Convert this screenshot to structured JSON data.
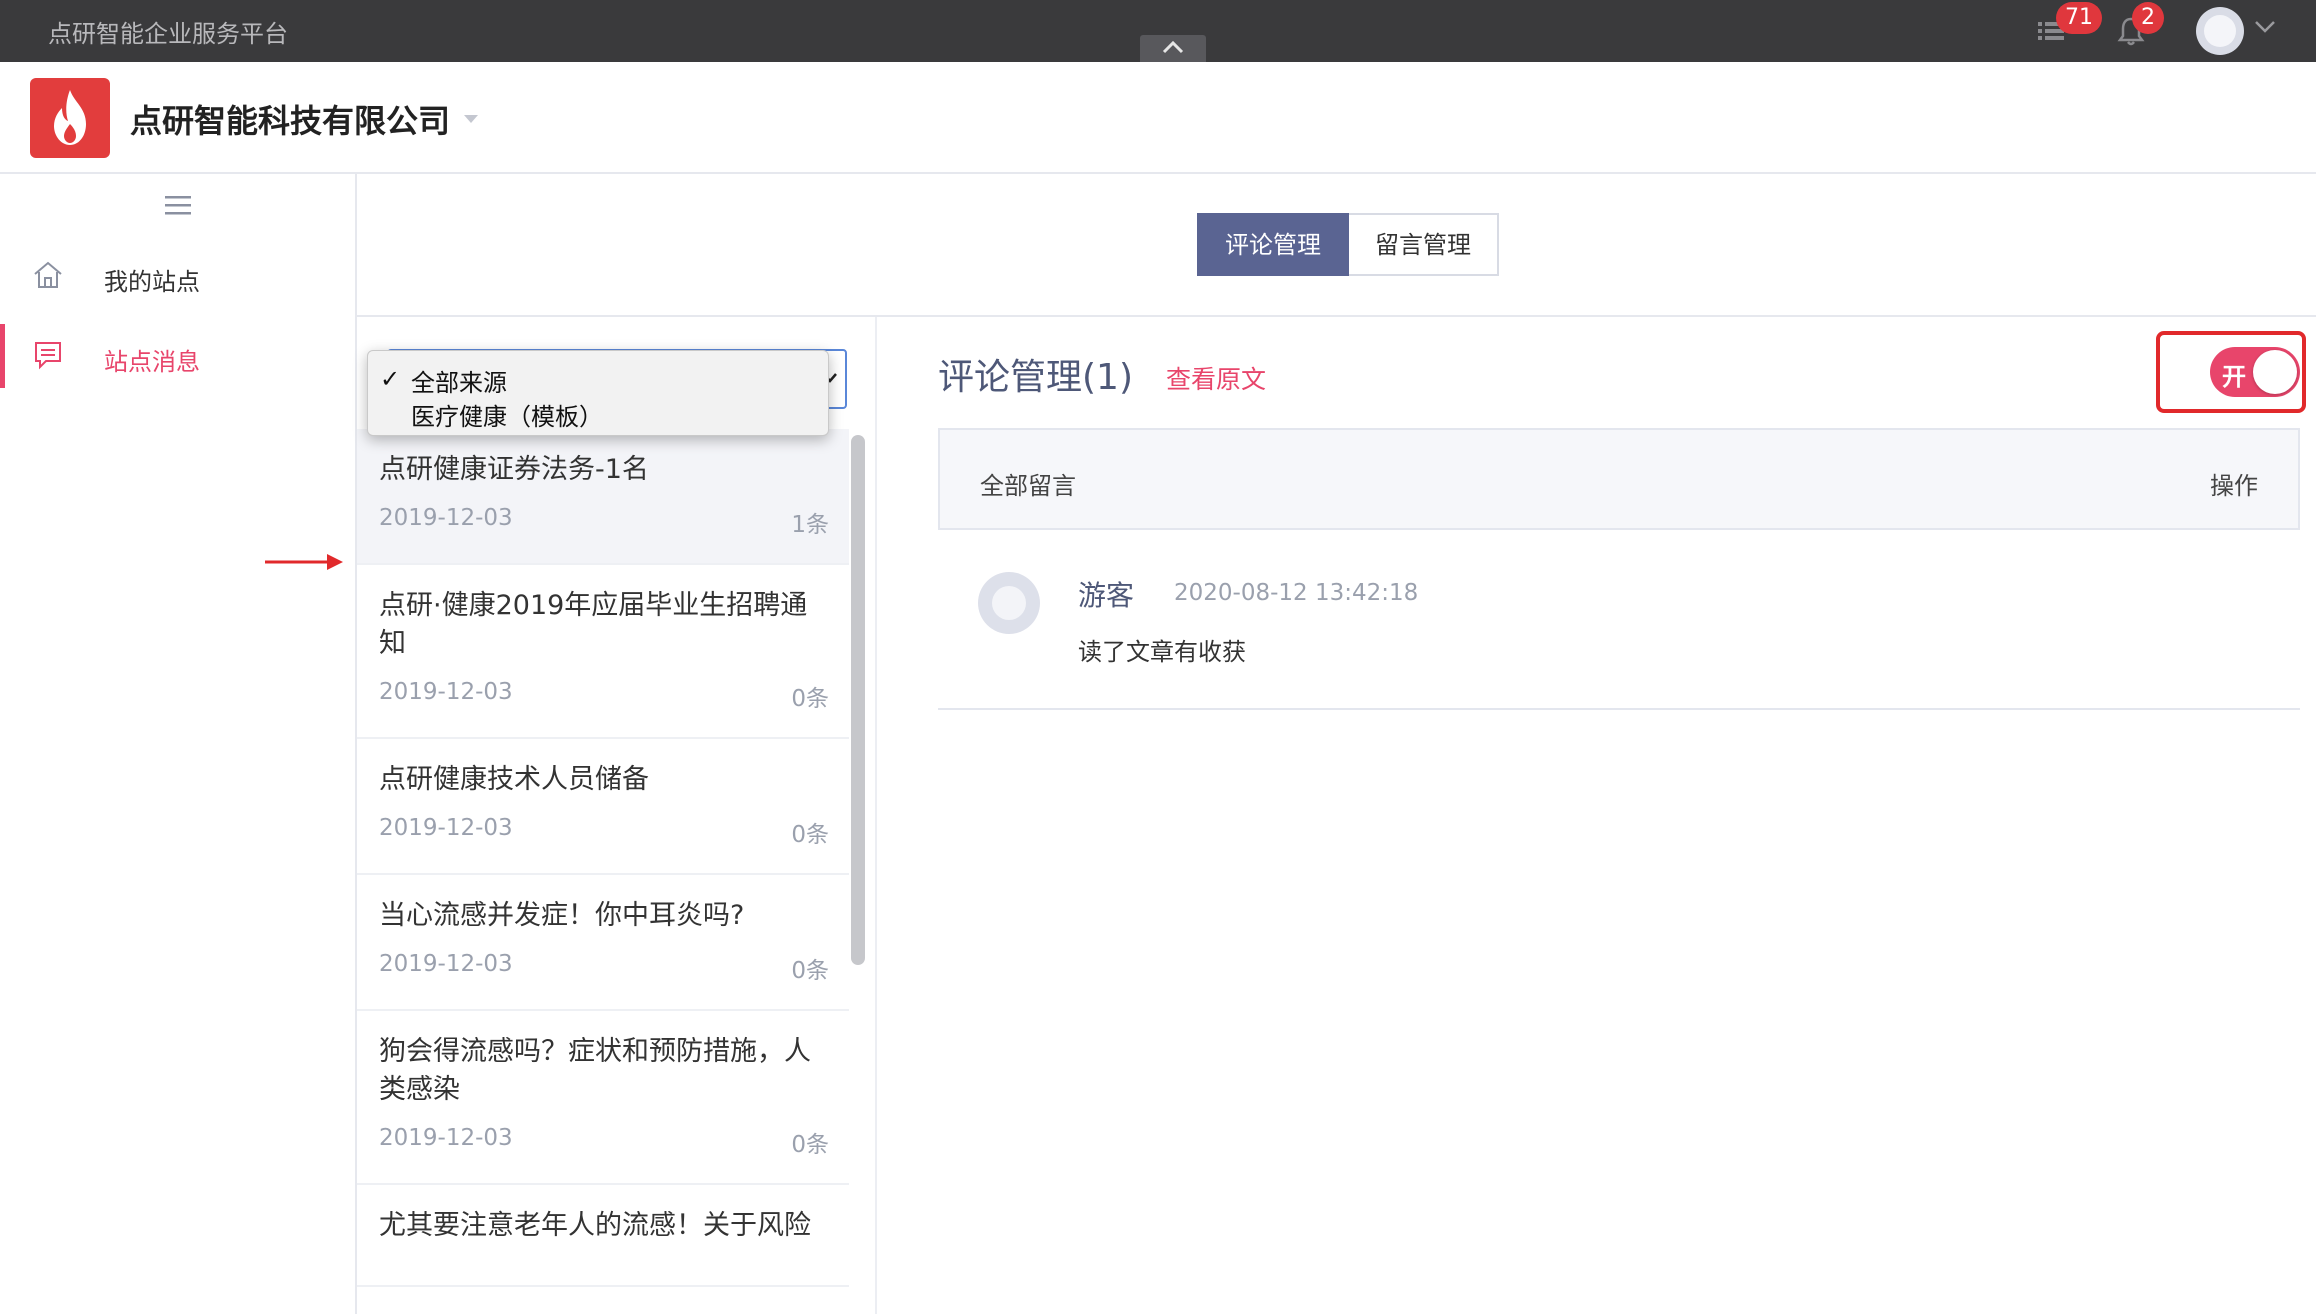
{
  "topbar": {
    "title": "点研智能企业服务平台",
    "list_badge": "71",
    "bell_badge": "2"
  },
  "header": {
    "company": "点研智能科技有限公司"
  },
  "sidebar": {
    "items": [
      {
        "label": "我的站点",
        "icon": "home-icon",
        "active": false
      },
      {
        "label": "站点消息",
        "icon": "message-icon",
        "active": true
      }
    ]
  },
  "tabs": [
    {
      "label": "评论管理",
      "active": true
    },
    {
      "label": "留言管理",
      "active": false
    }
  ],
  "source_filter": {
    "options": [
      "全部来源",
      "医疗健康（模板）"
    ],
    "selected": "全部来源",
    "check": "✓"
  },
  "articles": [
    {
      "title": "点研健康证券法务-1名",
      "date": "2019-12-03",
      "count": "1条"
    },
    {
      "title": "点研·健康2019年应届毕业生招聘通知",
      "date": "2019-12-03",
      "count": "0条"
    },
    {
      "title": "点研健康技术人员储备",
      "date": "2019-12-03",
      "count": "0条"
    },
    {
      "title": "当心流感并发症！你中耳炎吗?",
      "date": "2019-12-03",
      "count": "0条"
    },
    {
      "title": "狗会得流感吗？症状和预防措施，人类感染",
      "date": "2019-12-03",
      "count": "0条"
    },
    {
      "title": "尤其要注意老年人的流感！关于风险",
      "date": "",
      "count": ""
    }
  ],
  "comments_panel": {
    "title": "评论管理(1)",
    "view_original": "查看原文",
    "toggle_label": "开",
    "toggle_on": true,
    "table_header_left": "全部留言",
    "table_header_right": "操作",
    "comments": [
      {
        "user": "游客",
        "time": "2020-08-12 13:42:18",
        "text": "读了文章有收获"
      }
    ]
  },
  "colors": {
    "accent": "#e8456b",
    "tab_active": "#5a6492",
    "topbar": "#3a3a3c",
    "highlight_frame": "#e1292b"
  }
}
